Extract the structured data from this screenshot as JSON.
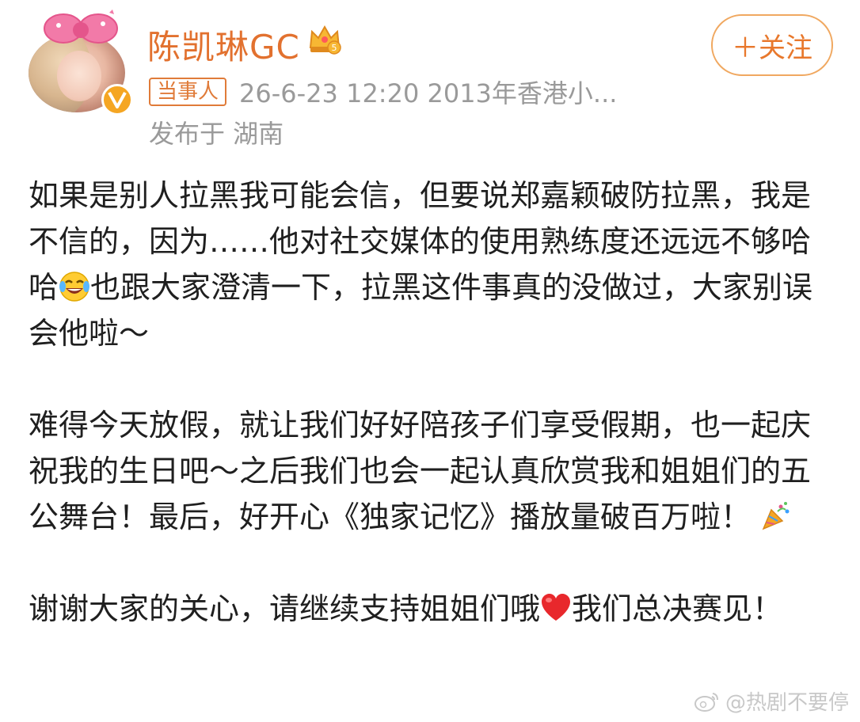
{
  "author": {
    "name": "陈凯琳GC",
    "avatar_icon": "avatar-photo",
    "verified_icon": "verified-badge-icon",
    "crown_badge": "crown-level-icon",
    "crown_level": "5"
  },
  "follow_button": {
    "label": "＋关注"
  },
  "meta": {
    "tag": "当事人",
    "timestamp_source": "26-6-23 12:20  2013年香港小...",
    "location": "发布于 湖南"
  },
  "post": {
    "p1_a": "如果是别人拉黑我可能会信，但要说郑嘉颖破防拉黑，我是不信的，因为……他对社交媒体的使用熟练度还远远不够哈哈",
    "p1_b": "也跟大家澄清一下，拉黑这件事真的没做过，大家别误会他啦～",
    "p2_a": "难得今天放假，就让我们好好陪孩子们享受假期，也一起庆祝我的生日吧～之后我们也会一起认真欣赏我和姐姐们的五公舞台！最后，好开心《独家记忆》播放量破百万啦！",
    "p3_a": "谢谢大家的关心，请继续支持姐姐们哦",
    "p3_b": "我们总决赛见！"
  },
  "watermark": "@热剧不要停",
  "colors": {
    "accent": "#e2712f",
    "meta_gray": "#9a9a9a",
    "text": "#1f1f1f"
  }
}
